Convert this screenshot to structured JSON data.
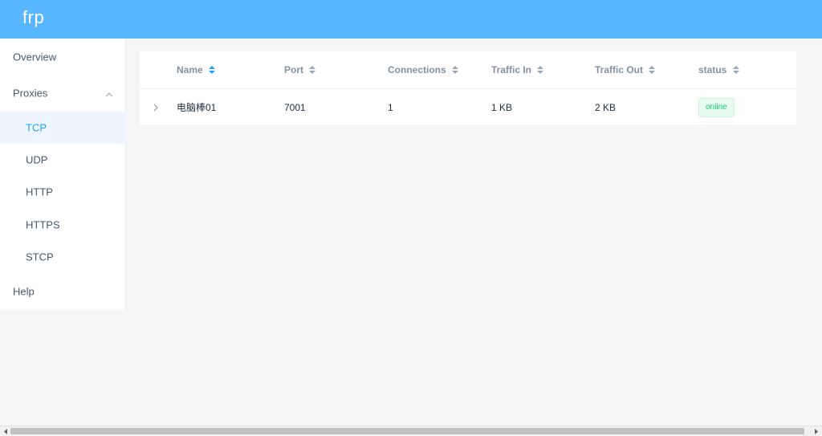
{
  "header": {
    "brand": "frp"
  },
  "sidebar": {
    "items": [
      {
        "label": "Overview"
      },
      {
        "label": "Proxies"
      },
      {
        "label": "TCP"
      },
      {
        "label": "UDP"
      },
      {
        "label": "HTTP"
      },
      {
        "label": "HTTPS"
      },
      {
        "label": "STCP"
      },
      {
        "label": "Help"
      }
    ],
    "active": "TCP"
  },
  "table": {
    "columns": [
      "Name",
      "Port",
      "Connections",
      "Traffic In",
      "Traffic Out",
      "status"
    ],
    "rows": [
      {
        "name": "电脑棒01",
        "port": "7001",
        "connections": "1",
        "traffic_in": "1 KB",
        "traffic_out": "2 KB",
        "status": "online"
      }
    ]
  },
  "colors": {
    "header": "#58b7ff",
    "active_text": "#20a0ff",
    "active_bg": "#eef5fe",
    "online": "#13ce66"
  },
  "icons": {
    "expand": "chevron-right-icon",
    "submenu": "chevron-up-icon",
    "sort": "sort-caret-icon"
  }
}
